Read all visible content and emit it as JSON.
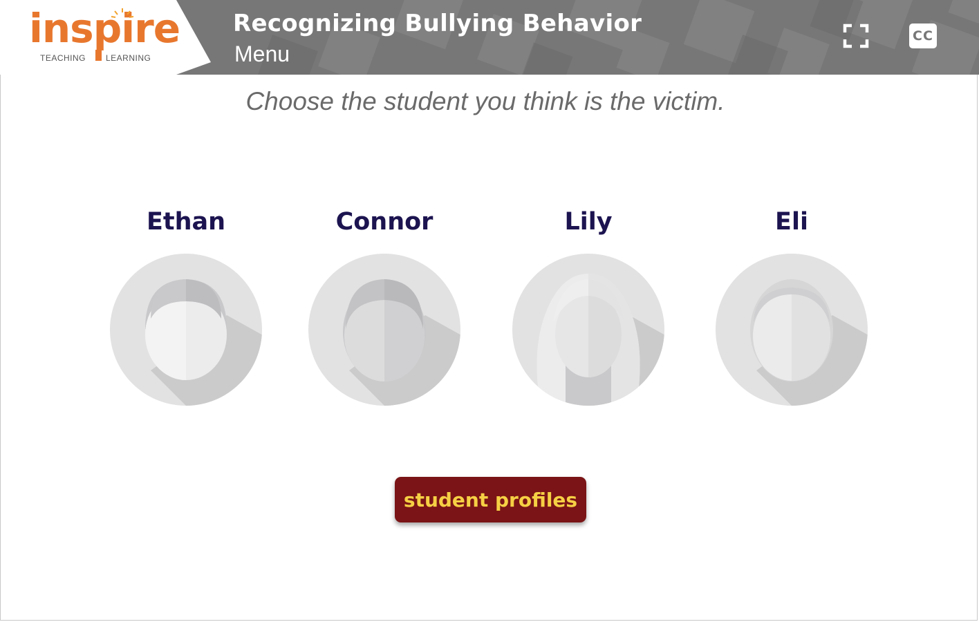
{
  "logo": {
    "word": "inspire",
    "sub_left": "TEACHING",
    "sub_right": "LEARNING"
  },
  "header": {
    "title": "Recognizing Bullying Behavior",
    "subtitle": "Menu"
  },
  "controls": {
    "fullscreen_icon": "fullscreen-icon",
    "cc_label": "CC"
  },
  "instruction": "Choose the student you think is the victim.",
  "students": [
    {
      "name": "Ethan",
      "avatar": "male-avatar"
    },
    {
      "name": "Connor",
      "avatar": "male-avatar"
    },
    {
      "name": "Lily",
      "avatar": "female-avatar"
    },
    {
      "name": "Eli",
      "avatar": "male-avatar"
    }
  ],
  "profiles_button": "student profiles",
  "colors": {
    "header_bg": "#767676",
    "logo_orange": "#e8772e",
    "name_color": "#1c1450",
    "button_bg": "#7a1416",
    "button_text": "#f6d044"
  }
}
